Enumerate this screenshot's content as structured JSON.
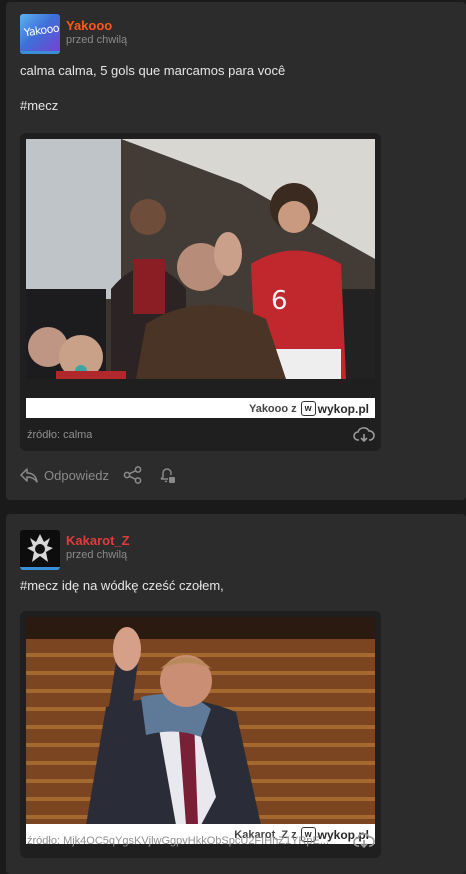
{
  "posts": [
    {
      "author": "Yakooo",
      "time": "przed chwilą",
      "avatar_text": "Yakooo",
      "line1": "calma calma, 5 gols que marcamos para você",
      "line2": "#mecz",
      "watermark_user": "Yakooo z",
      "watermark_site": "wykop.pl",
      "source": "źródło: calma",
      "actions": {
        "reply": "Odpowiedz"
      }
    },
    {
      "author": "Kakarot_Z",
      "time": "przed chwilą",
      "line1": "#mecz idę na wódkę cześć czołem,",
      "watermark_user": "Kakarot_Z z",
      "watermark_site": "wykop.pl",
      "source": "źródło: Mjk4OC5qYgsKVjlwGgpvHkkObSpcU2FIHhZ1YRpE..."
    }
  ],
  "colors": {
    "card_bg": "#2c2c2d",
    "page_bg": "#1a1a1b",
    "author1": "#ff5917",
    "author2": "#e23b3b",
    "avatar_bar": "#3b8fd6"
  }
}
